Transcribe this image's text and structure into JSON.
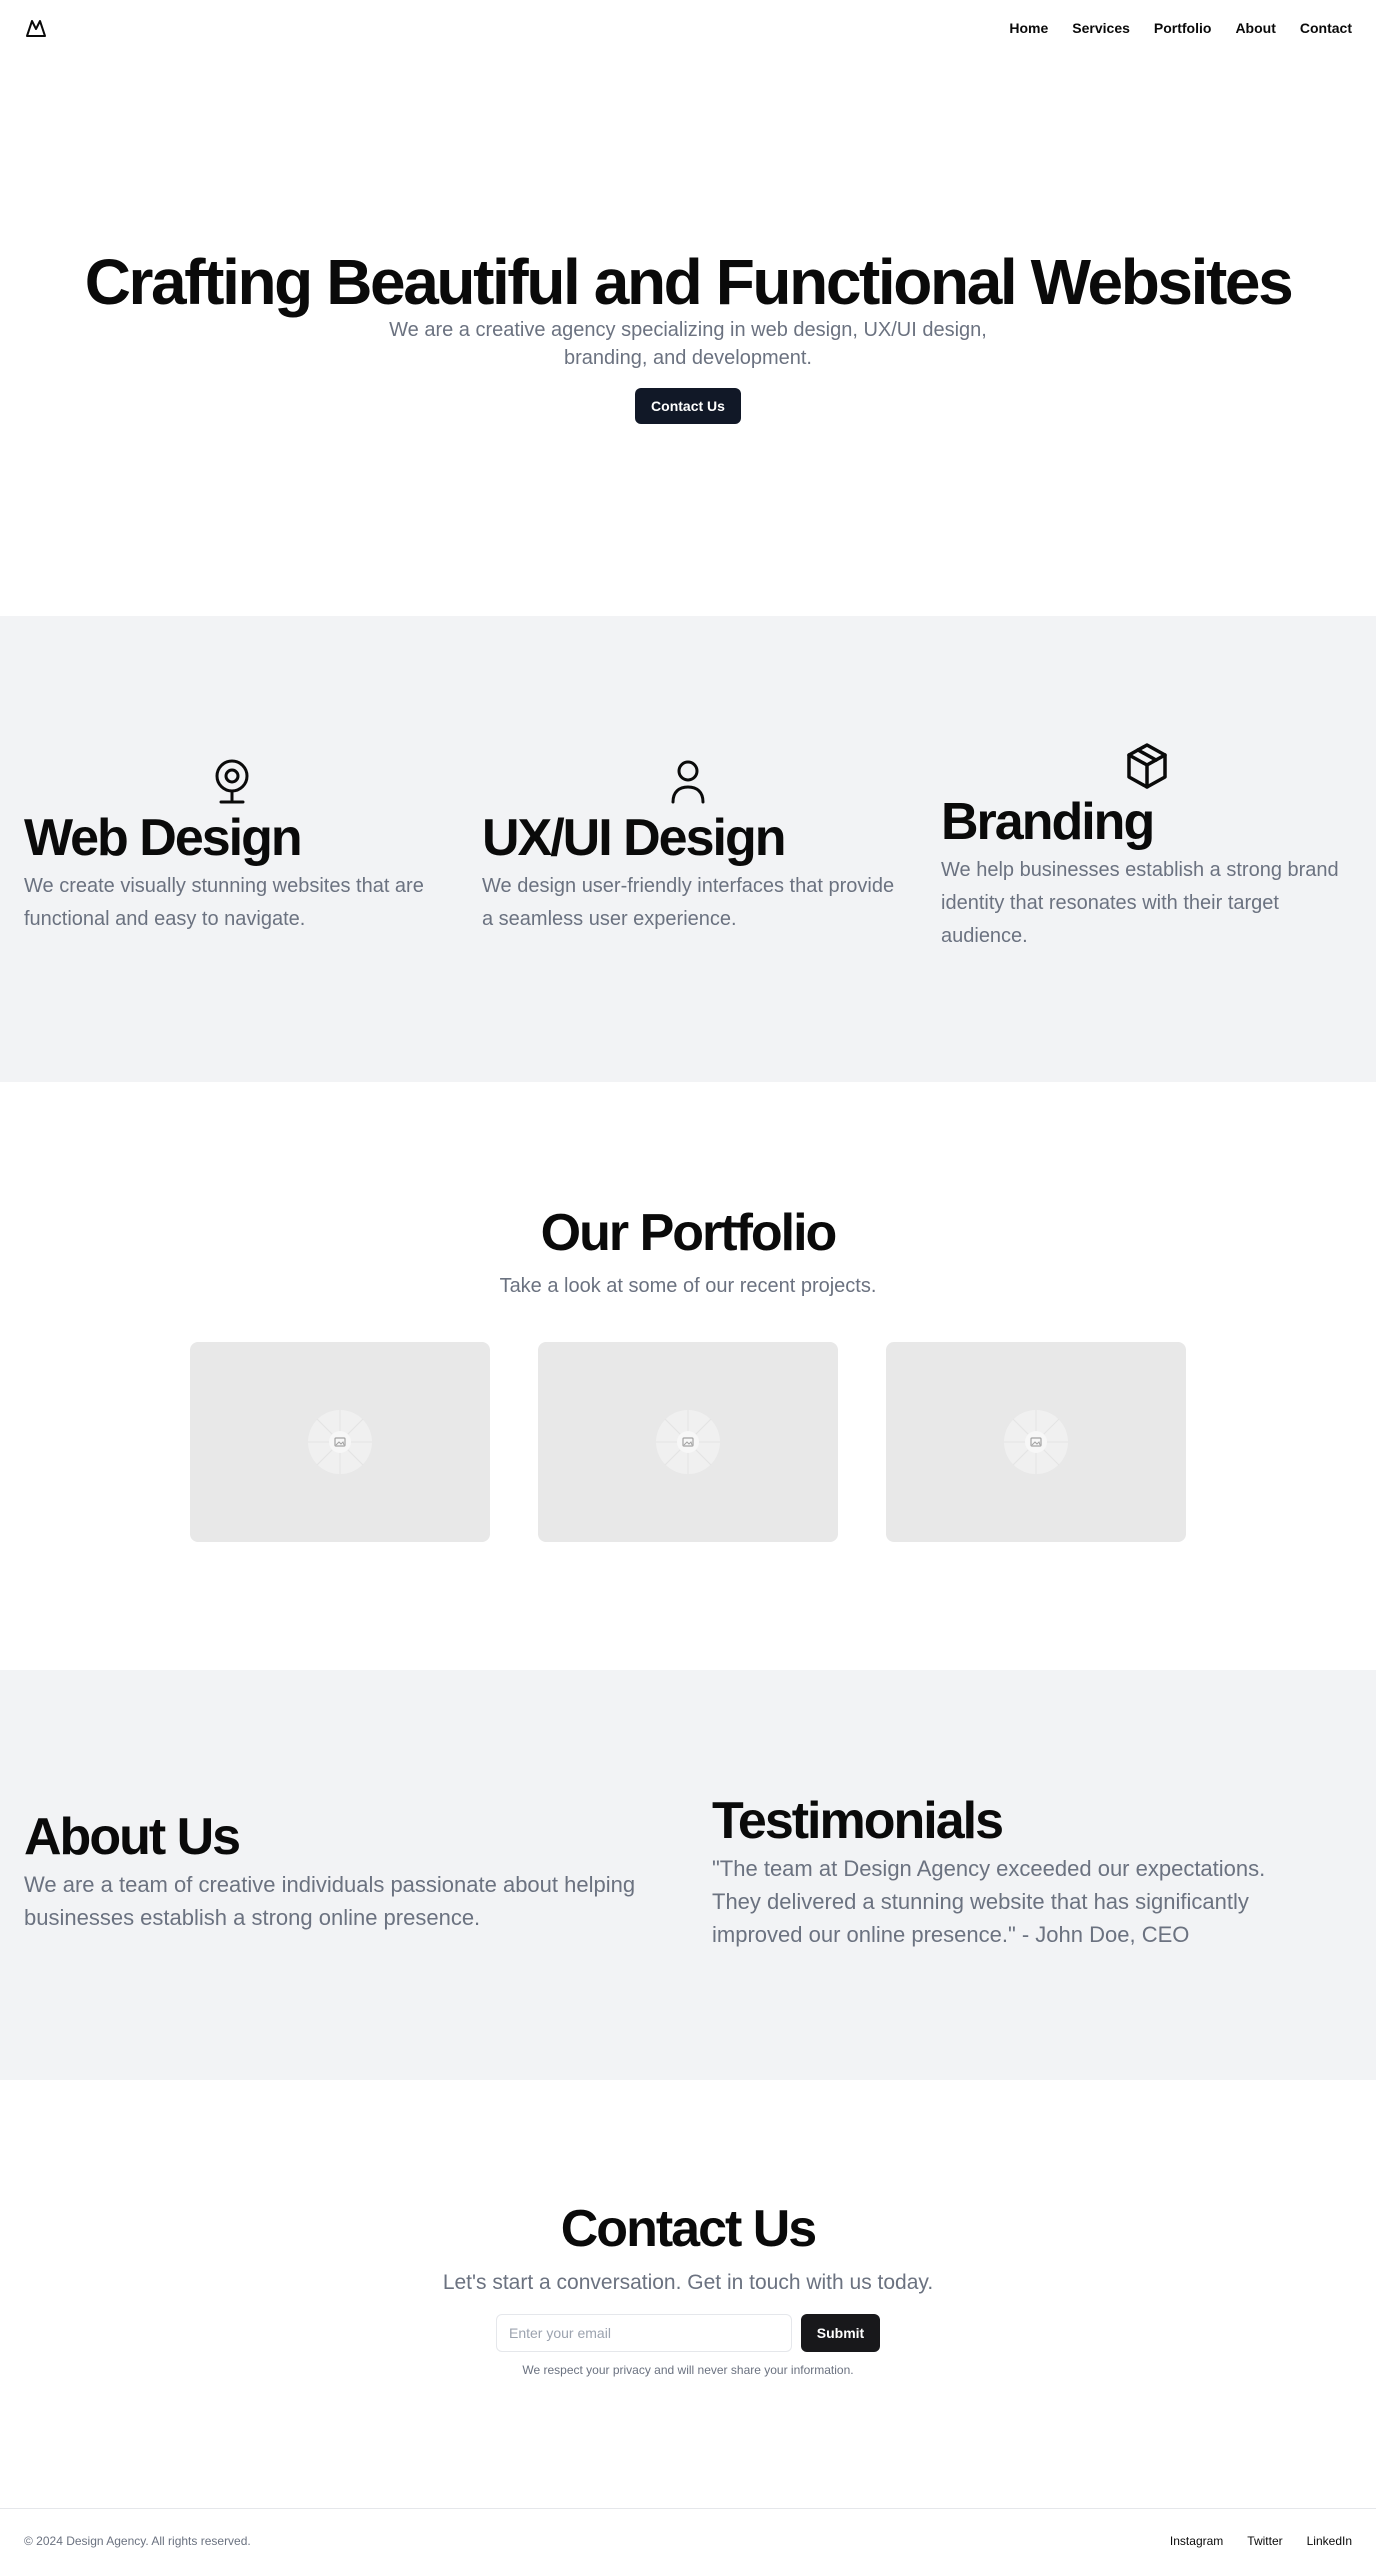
{
  "header": {
    "logo_icon": "mountain-icon",
    "nav": [
      "Home",
      "Services",
      "Portfolio",
      "About",
      "Contact"
    ]
  },
  "hero": {
    "title": "Crafting Beautiful and Functional Websites",
    "subtitle": "We are a creative agency specializing in web design, UX/UI design, branding, and development.",
    "cta": "Contact Us"
  },
  "services": [
    {
      "icon": "webcam-icon",
      "title": "Web Design",
      "text": "We create visually stunning websites that are functional and easy to navigate."
    },
    {
      "icon": "user-icon",
      "title": "UX/UI Design",
      "text": "We design user-friendly interfaces that provide a seamless user experience."
    },
    {
      "icon": "package-icon",
      "title": "Branding",
      "text": "We help businesses establish a strong brand identity that resonates with their target audience."
    }
  ],
  "portfolio": {
    "title": "Our Portfolio",
    "subtitle": "Take a look at some of our recent projects.",
    "items": [
      "image-placeholder",
      "image-placeholder",
      "image-placeholder"
    ]
  },
  "about": {
    "title": "About Us",
    "text": "We are a team of creative individuals passionate about helping businesses establish a strong online presence."
  },
  "testimonials": {
    "title": "Testimonials",
    "text": "\"The team at Design Agency exceeded our expectations. They delivered a stunning website that has significantly improved our online presence.\" - John Doe, CEO"
  },
  "contact": {
    "title": "Contact Us",
    "subtitle": "Let's start a conversation. Get in touch with us today.",
    "email_placeholder": "Enter your email",
    "email_value": "",
    "submit": "Submit",
    "note": "We respect your privacy and will never share your information."
  },
  "footer": {
    "copyright": "© 2024 Design Agency. All rights reserved.",
    "links": [
      "Instagram",
      "Twitter",
      "LinkedIn"
    ]
  },
  "colors": {
    "primary_button": "#111827",
    "section_bg": "#f2f3f5",
    "muted_text": "#6b7280"
  }
}
